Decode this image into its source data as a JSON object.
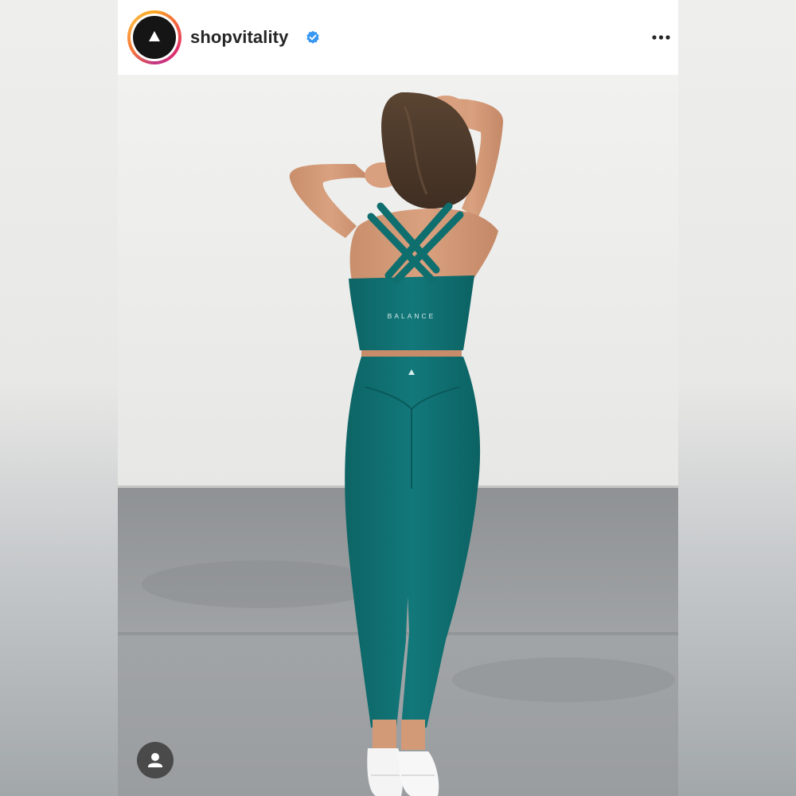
{
  "post": {
    "username": "shopvitality",
    "verified": true,
    "avatar_icon": "triangle-logo-icon",
    "more_icon": "more-options-icon",
    "tag_icon": "user-tag-icon"
  },
  "photo": {
    "garment_logo": "BALANCE",
    "subject": "woman in teal sports bra and leggings facing away"
  },
  "colors": {
    "teal_garment": "#0f6e6e",
    "verified_blue": "#3897f0",
    "text": "#262626"
  }
}
